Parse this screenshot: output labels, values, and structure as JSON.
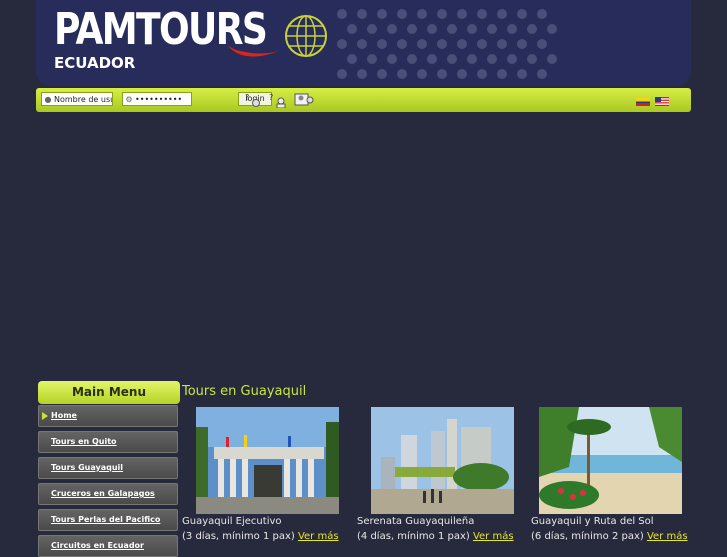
{
  "header": {
    "logo_main": "PAMTOURS",
    "logo_sub": "ECUADOR"
  },
  "toolbar": {
    "username_placeholder": "Nombre de usu",
    "password_value": "••••••••••",
    "login_label": "login",
    "icons": [
      "help-key-icon",
      "help-user-icon",
      "users-icon"
    ],
    "flags": [
      "ecuador-flag-icon",
      "usa-flag-icon"
    ]
  },
  "sidebar": {
    "title": "Main Menu",
    "items": [
      {
        "label": "Home"
      },
      {
        "label": "Tours en Quito"
      },
      {
        "label": "Tours Guayaquil"
      },
      {
        "label": "Cruceros en Galapagos"
      },
      {
        "label": "Tours Perlas del Pacifico"
      },
      {
        "label": "Circuitos en Ecuador"
      }
    ]
  },
  "main": {
    "title": "Tours en Guayaquil",
    "tours": [
      {
        "name": "Guayaquil Ejecutivo",
        "info": "(3 días, mínimo 1 pax)",
        "more": "Ver más"
      },
      {
        "name": "Serenata Guayaquileña",
        "info": "(4 días, mínimo 1 pax)",
        "more": "Ver más"
      },
      {
        "name": "Guayaquil y Ruta del Sol",
        "info": "(6 días, mínimo 2 pax)",
        "more": "Ver más"
      }
    ]
  },
  "colors": {
    "accent_green": "#c8e642",
    "header_navy": "#282c5a",
    "logo_red": "#e2231a",
    "link_yellow": "#e6e62a"
  }
}
